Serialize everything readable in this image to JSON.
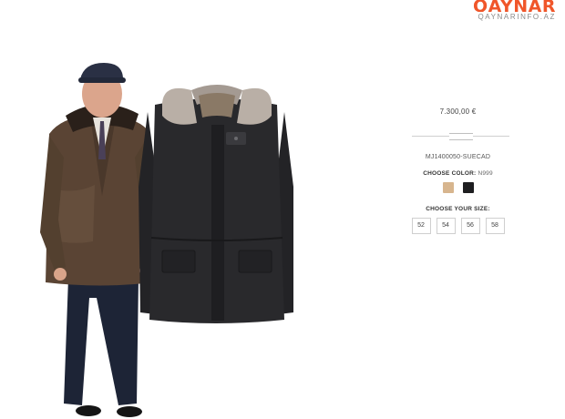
{
  "watermark": {
    "brand": "QAYNAR",
    "site": "QAYNARINFO.AZ",
    "color": "#f0562a"
  },
  "product": {
    "price": "7.300,00 €",
    "sku": "MJ1400050-SUECAD",
    "color_label": "CHOOSE COLOR:",
    "color_code": "N999",
    "colors": [
      {
        "name": "beige-swatch",
        "hex": "#d7b58e"
      },
      {
        "name": "black-swatch",
        "hex": "#1e1e20"
      }
    ],
    "size_label": "CHOOSE YOUR SIZE:",
    "sizes": [
      "52",
      "54",
      "56",
      "58"
    ]
  }
}
